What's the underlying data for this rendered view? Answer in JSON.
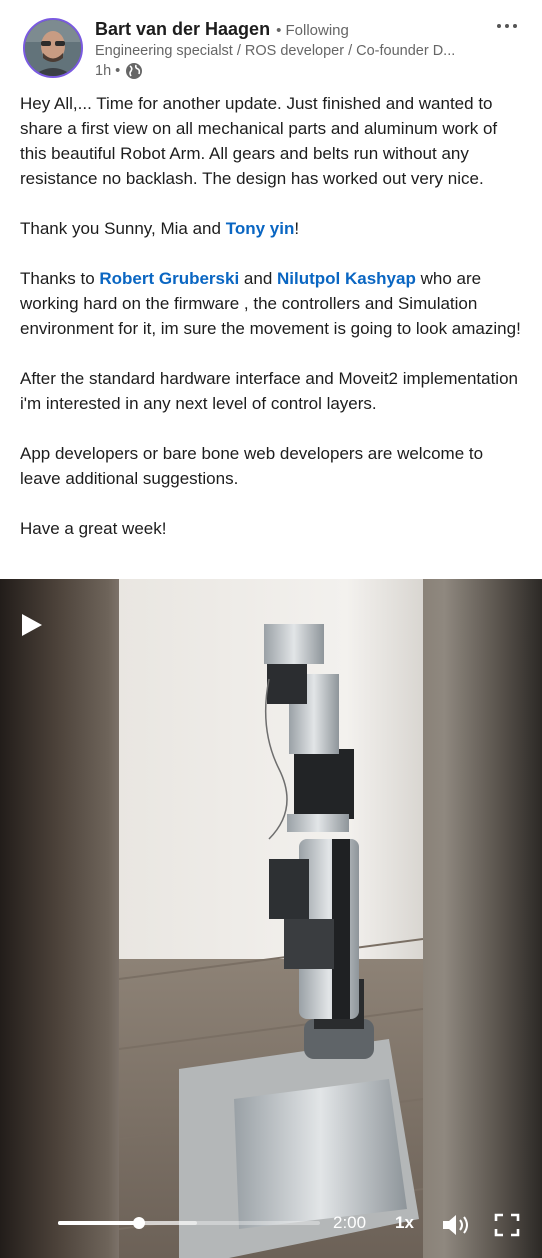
{
  "post": {
    "author": {
      "name": "Bart van der Haagen",
      "follow_status": "• Following",
      "headline": "Engineering specialst / ROS developer / Co-founder D...",
      "time": "1h •"
    },
    "paragraphs": [
      [
        {
          "text": "Hey All,... Time for another update. Just finished and wanted to share a first view on all mechanical parts and aluminum work of this beautiful Robot Arm. All gears and belts run without any resistance no backlash. The design has worked out very nice."
        }
      ],
      [
        {
          "text": "Thank you Sunny, Mia and "
        },
        {
          "text": "Tony yin",
          "mention": true
        },
        {
          "text": "!"
        }
      ],
      [
        {
          "text": "Thanks to "
        },
        {
          "text": "Robert Gruberski",
          "mention": true
        },
        {
          "text": " and "
        },
        {
          "text": "Nilutpol Kashyap",
          "mention": true
        },
        {
          "text": " who are working hard on the firmware , the controllers and Simulation environment for it, im sure the movement is going to look amazing!"
        }
      ],
      [
        {
          "text": "After the standard hardware interface and Moveit2 implementation i'm interested in any next level of control layers."
        }
      ],
      [
        {
          "text": "App developers or bare bone web developers are welcome to leave additional suggestions."
        }
      ],
      [
        {
          "text": "Have a great week!"
        }
      ]
    ]
  },
  "video": {
    "time_remaining": "2:00",
    "speed": "1x",
    "progress_played": 0.31,
    "progress_buffered": 0.53
  },
  "icons": {
    "more": "more-horizontal-icon",
    "visibility": "globe-icon",
    "play": "play-icon",
    "volume": "volume-icon",
    "fullscreen": "fullscreen-icon"
  },
  "colors": {
    "mention": "#0a66c2",
    "text": "#1d1d1d",
    "secondary": "#666666",
    "avatar_ring": "#7a5ae0"
  }
}
